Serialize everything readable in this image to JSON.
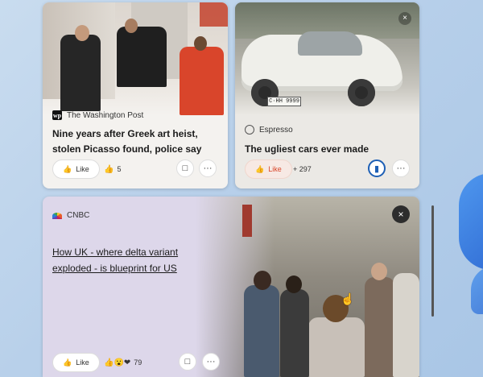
{
  "cards": [
    {
      "source": "The Washington Post",
      "source_logo": "wapo-logo",
      "headline": "Nine years after Greek art heist, stolen Picasso found, police say",
      "like_label": "Like",
      "reaction_count": "5",
      "reaction_icon": "thumbs-up-emoji"
    },
    {
      "source": "Espresso",
      "source_logo": "espresso-logo",
      "headline": "The ugliest cars ever made",
      "like_label": "Like",
      "reaction_count": "+ 297",
      "plate_text": "C·HH 9999",
      "close_label": "×"
    },
    {
      "source": "CNBC",
      "source_logo": "cnbc-logo",
      "headline": "How UK - where delta variant exploded - is blueprint for US",
      "like_label": "Like",
      "reaction_count": "79",
      "reaction_icon": "mixed-reactions-emoji",
      "close_label": "×"
    }
  ],
  "colors": {
    "liked_accent": "#d9462a",
    "saved_accent": "#1d5fb5"
  }
}
